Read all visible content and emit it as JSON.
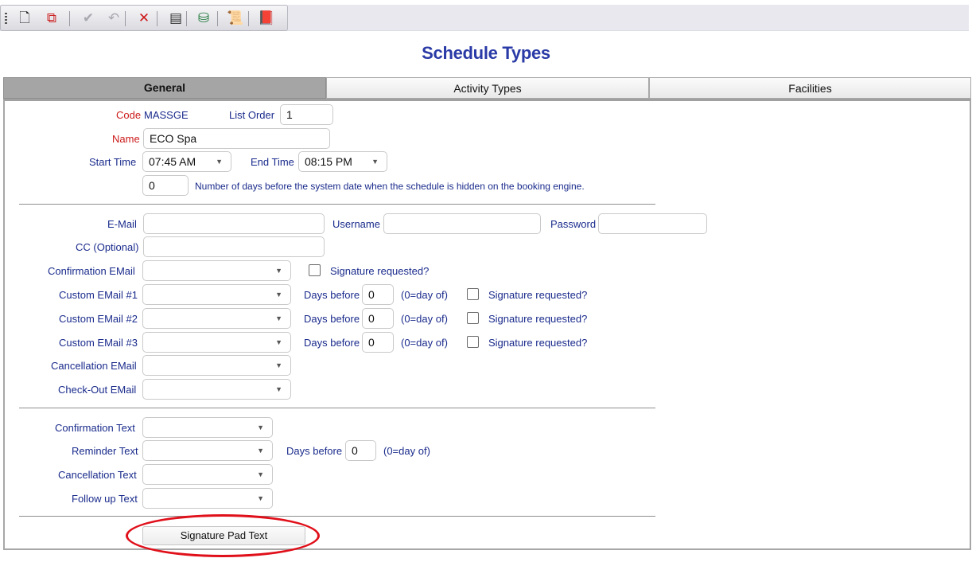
{
  "toolbar": {
    "buttons": [
      {
        "icon": "new-document-icon",
        "glyph": "🗋",
        "color": "#222222"
      },
      {
        "icon": "copy-document-icon",
        "glyph": "⧉",
        "color": "#cc2222"
      },
      {
        "icon": "save-check-icon",
        "glyph": "✔",
        "color": "#a8a8b0"
      },
      {
        "icon": "undo-icon",
        "glyph": "↶",
        "color": "#a8a8b0"
      },
      {
        "icon": "delete-icon",
        "glyph": "✕",
        "color": "#cc1a1a"
      },
      {
        "icon": "report-icon",
        "glyph": "▤",
        "color": "#333333"
      },
      {
        "icon": "export-icon",
        "glyph": "⛁",
        "color": "#1f7a3a"
      },
      {
        "icon": "script-icon",
        "glyph": "📜",
        "color": "#333333"
      },
      {
        "icon": "help-book-icon",
        "glyph": "📕",
        "color": "#7a2a8a"
      }
    ]
  },
  "page": {
    "title": "Schedule Types"
  },
  "tabs": [
    {
      "label": "General",
      "active": true
    },
    {
      "label": "Activity Types",
      "active": false
    },
    {
      "label": "Facilities",
      "active": false
    }
  ],
  "general": {
    "code_label": "Code",
    "code_value": "MASSGE",
    "list_order_label": "List Order",
    "list_order_value": "1",
    "name_label": "Name",
    "name_value": "ECO Spa",
    "start_time_label": "Start Time",
    "start_time_value": "07:45 AM",
    "end_time_label": "End Time",
    "end_time_value": "08:15 PM",
    "days_hidden_value": "0",
    "days_hidden_text": "Number of days before the system date when the schedule is hidden on the booking engine."
  },
  "email": {
    "email_label": "E-Mail",
    "email_value": "",
    "username_label": "Username",
    "username_value": "",
    "password_label": "Password",
    "password_value": "",
    "cc_label": "CC (Optional)",
    "cc_value": "",
    "confirmation_label": "Confirmation EMail",
    "confirmation_value": "",
    "signature_requested_label": "Signature requested?",
    "custom1_label": "Custom EMail #1",
    "custom2_label": "Custom EMail #2",
    "custom3_label": "Custom EMail #3",
    "days_before_label": "Days before",
    "custom1_days": "0",
    "custom2_days": "0",
    "custom3_days": "0",
    "day_of_hint": "(0=day of)",
    "cancellation_label": "Cancellation EMail",
    "checkout_label": "Check-Out EMail"
  },
  "text": {
    "confirmation_label": "Confirmation Text",
    "reminder_label": "Reminder Text",
    "reminder_days_label": "Days before",
    "reminder_days_value": "0",
    "day_of_hint": "(0=day of)",
    "cancellation_label": "Cancellation Text",
    "followup_label": "Follow up Text"
  },
  "signature_pad_button": "Signature Pad Text",
  "colors": {
    "label": "#1a2b8c",
    "required_label": "#cc1a1a",
    "title": "#2a3aa6",
    "highlight_oval": "#e0101a"
  }
}
